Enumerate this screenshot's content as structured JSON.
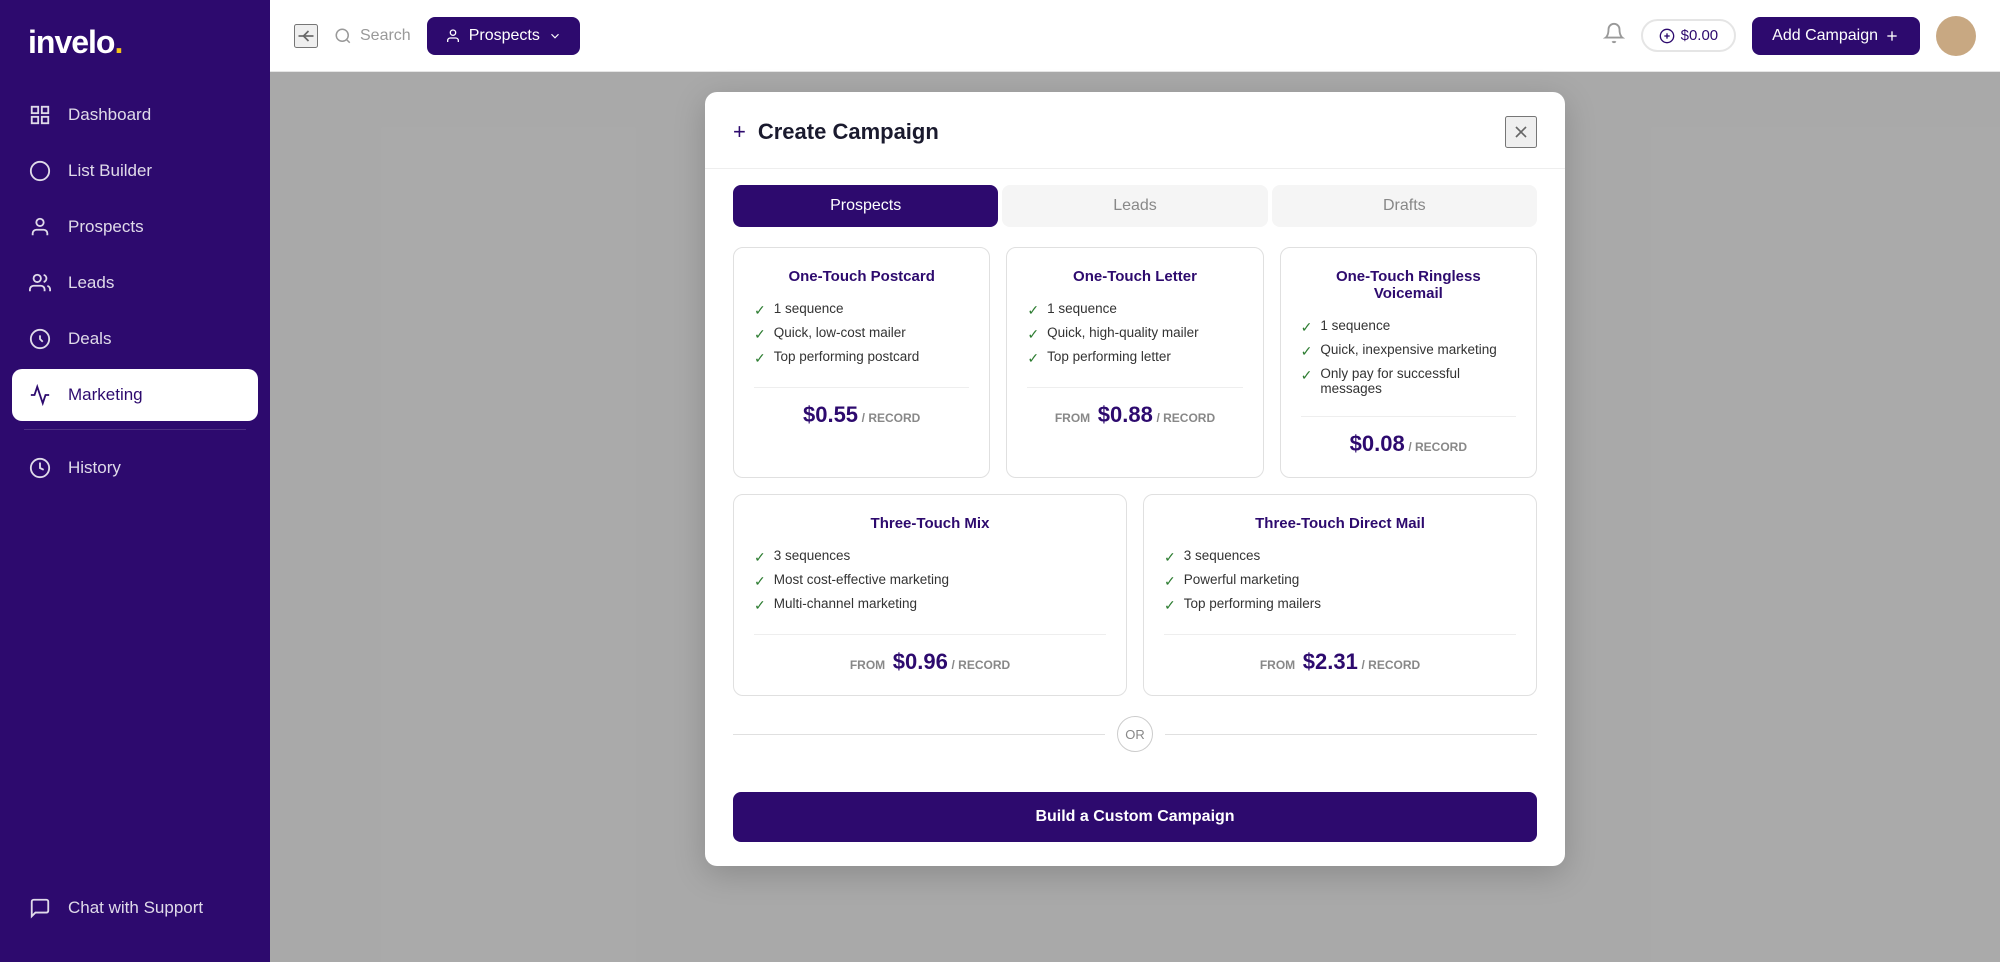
{
  "app": {
    "logo_text": "invelo",
    "logo_dot": "."
  },
  "sidebar": {
    "items": [
      {
        "id": "dashboard",
        "label": "Dashboard",
        "icon": "dashboard-icon"
      },
      {
        "id": "list-builder",
        "label": "List Builder",
        "icon": "list-builder-icon"
      },
      {
        "id": "prospects",
        "label": "Prospects",
        "icon": "prospects-icon"
      },
      {
        "id": "leads",
        "label": "Leads",
        "icon": "leads-icon"
      },
      {
        "id": "deals",
        "label": "Deals",
        "icon": "deals-icon"
      },
      {
        "id": "marketing",
        "label": "Marketing",
        "icon": "marketing-icon",
        "active": true
      },
      {
        "id": "history",
        "label": "History",
        "icon": "history-icon"
      }
    ],
    "bottom_items": [
      {
        "id": "chat",
        "label": "Chat with Support",
        "icon": "chat-icon"
      }
    ]
  },
  "topbar": {
    "search_placeholder": "Search",
    "prospects_btn": "Prospects",
    "balance": "$0.00",
    "add_campaign_btn": "Add Campaign"
  },
  "modal": {
    "title": "Create Campaign",
    "tabs": [
      {
        "id": "prospects",
        "label": "Prospects",
        "active": true
      },
      {
        "id": "leads",
        "label": "Leads",
        "active": false
      },
      {
        "id": "drafts",
        "label": "Drafts",
        "active": false
      }
    ],
    "cards_row1": [
      {
        "id": "one-touch-postcard",
        "title": "One-Touch Postcard",
        "features": [
          "1 sequence",
          "Quick, low-cost mailer",
          "Top performing postcard"
        ],
        "price_from": "",
        "price": "$0.55",
        "per": "/ RECORD"
      },
      {
        "id": "one-touch-letter",
        "title": "One-Touch Letter",
        "features": [
          "1 sequence",
          "Quick, high-quality mailer",
          "Top performing letter"
        ],
        "price_from": "FROM",
        "price": "$0.88",
        "per": "/ RECORD"
      },
      {
        "id": "one-touch-ringless",
        "title": "One-Touch Ringless Voicemail",
        "features": [
          "1 sequence",
          "Quick, inexpensive marketing",
          "Only pay for successful messages"
        ],
        "price_from": "",
        "price": "$0.08",
        "per": "/ RECORD"
      }
    ],
    "cards_row2": [
      {
        "id": "three-touch-mix",
        "title": "Three-Touch Mix",
        "features": [
          "3 sequences",
          "Most cost-effective marketing",
          "Multi-channel marketing"
        ],
        "price_from": "FROM",
        "price": "$0.96",
        "per": "/ RECORD"
      },
      {
        "id": "three-touch-direct",
        "title": "Three-Touch Direct Mail",
        "features": [
          "3 sequences",
          "Powerful marketing",
          "Top performing mailers"
        ],
        "price_from": "FROM",
        "price": "$2.31",
        "per": "/ RECORD"
      }
    ],
    "or_text": "OR",
    "custom_btn": "Build a Custom Campaign"
  }
}
